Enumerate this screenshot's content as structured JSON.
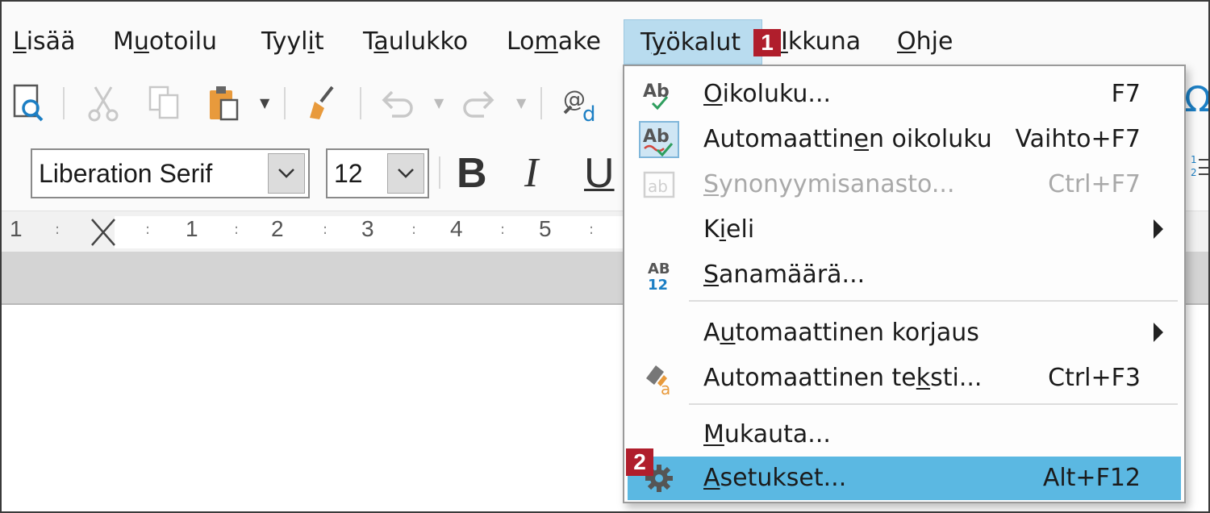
{
  "menubar": {
    "items": [
      {
        "pre": "",
        "u": "L",
        "post": "isää"
      },
      {
        "pre": "M",
        "u": "u",
        "post": "otoilu"
      },
      {
        "pre": "Tyyl",
        "u": "i",
        "post": "t"
      },
      {
        "pre": "T",
        "u": "a",
        "post": "ulukko"
      },
      {
        "pre": "Lo",
        "u": "m",
        "post": "ake"
      },
      {
        "pre": "T",
        "u": "y",
        "post": "ökalut"
      },
      {
        "pre": "",
        "u": "I",
        "post": "kkuna"
      },
      {
        "pre": "",
        "u": "O",
        "post": "hje"
      }
    ]
  },
  "badges": {
    "one": "1",
    "two": "2"
  },
  "formatting": {
    "font_name": "Liberation Serif",
    "font_size": "12",
    "bold": "B",
    "italic": "I",
    "underline": "U"
  },
  "ruler": {
    "marks": [
      "1",
      "1",
      "2",
      "3",
      "4",
      "5"
    ]
  },
  "tools_menu": {
    "items": [
      {
        "pre": "",
        "u": "O",
        "post": "ikoluku...",
        "shortcut": "F7"
      },
      {
        "pre": "Automaattin",
        "u": "e",
        "post": "n oikoluku",
        "shortcut": "Vaihto+F7"
      },
      {
        "pre": "",
        "u": "S",
        "post": "ynonyymisanasto...",
        "shortcut": "Ctrl+F7"
      },
      {
        "pre": "K",
        "u": "i",
        "post": "eli",
        "shortcut": ""
      },
      {
        "pre": "",
        "u": "S",
        "post": "anamäärä...",
        "shortcut": ""
      },
      {
        "pre": "A",
        "u": "u",
        "post": "tomaattinen korjaus",
        "shortcut": ""
      },
      {
        "pre": "Automaattinen te",
        "u": "k",
        "post": "sti...",
        "shortcut": "Ctrl+F3"
      },
      {
        "pre": "",
        "u": "M",
        "post": "ukauta...",
        "shortcut": ""
      },
      {
        "pre": "",
        "u": "A",
        "post": "setukset...",
        "shortcut": "Alt+F12"
      }
    ]
  },
  "colors": {
    "active_menu_bg": "#b9dcef",
    "highlight_bg": "#5bb8e2",
    "badge_red": "#b01e2c",
    "icon_blue": "#1c7fc4",
    "icon_orange": "#e89a3c"
  }
}
